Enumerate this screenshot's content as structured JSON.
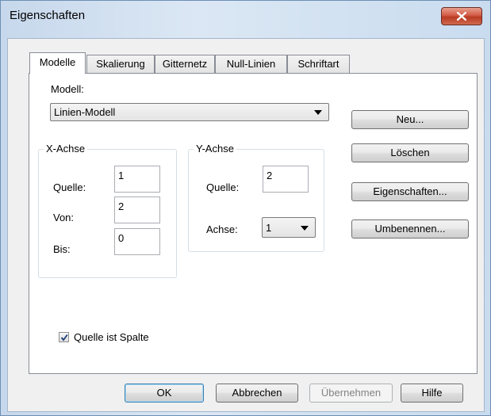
{
  "window": {
    "title": "Eigenschaften"
  },
  "tabs": [
    {
      "label": "Modelle",
      "active": true
    },
    {
      "label": "Skalierung",
      "active": false
    },
    {
      "label": "Gitternetz",
      "active": false
    },
    {
      "label": "Null-Linien",
      "active": false
    },
    {
      "label": "Schriftart",
      "active": false
    }
  ],
  "model": {
    "label": "Modell:",
    "selected": "Linien-Modell"
  },
  "x_axis": {
    "title": "X-Achse",
    "source_label": "Quelle:",
    "source_value": "1",
    "from_label": "Von:",
    "from_value": "2",
    "to_label": "Bis:",
    "to_value": "0"
  },
  "y_axis": {
    "title": "Y-Achse",
    "source_label": "Quelle:",
    "source_value": "2",
    "axis_label": "Achse:",
    "axis_value": "1"
  },
  "side_buttons": {
    "new": "Neu...",
    "delete": "Löschen",
    "properties": "Eigenschaften...",
    "rename": "Umbenennen..."
  },
  "checkbox": {
    "label": "Quelle ist Spalte",
    "checked": true
  },
  "footer": {
    "ok": "OK",
    "cancel": "Abbrechen",
    "apply": "Übernehmen",
    "help": "Hilfe"
  },
  "colors": {
    "close_button": "#c7472e",
    "accent": "#3c7fb1"
  }
}
